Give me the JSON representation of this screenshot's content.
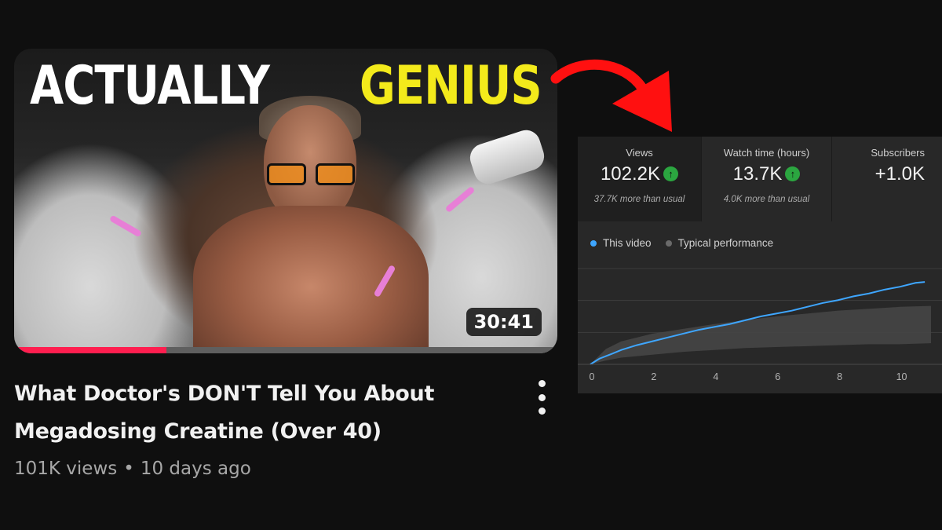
{
  "thumbnail": {
    "text_left": "ACTUALLY",
    "text_right": "GENIUS",
    "duration": "30:41",
    "watched_fraction": 0.28
  },
  "video": {
    "title_line1": "What Doctor's DON'T Tell You About",
    "title_line2": "Megadosing Creatine (Over 40)",
    "views": "101K views",
    "separator": "•",
    "age": "10 days ago",
    "menu_icon": "more-vert-icon"
  },
  "analytics": {
    "kpis": [
      {
        "label": "Views",
        "value": "102.2K",
        "trend": "up",
        "delta": "37.7K more than usual"
      },
      {
        "label": "Watch time (hours)",
        "value": "13.7K",
        "trend": "up",
        "delta": "4.0K more than usual"
      },
      {
        "label": "Subscribers",
        "value": "+1.0K"
      }
    ],
    "legend": [
      "This video",
      "Typical performance"
    ],
    "colors": {
      "this_video": "#3ea6ff",
      "typical": "#6a6a6a",
      "trend_up": "#2ba640"
    }
  },
  "chart_data": {
    "type": "line",
    "x_ticks": [
      "0",
      "2",
      "4",
      "6",
      "8",
      "10"
    ],
    "xlim": [
      0,
      11
    ],
    "ylim": [
      0,
      1
    ],
    "grid": true,
    "series": [
      {
        "name": "This video",
        "x": [
          0,
          0.3,
          0.7,
          1,
          1.5,
          2,
          2.5,
          3,
          3.5,
          4,
          4.5,
          5,
          5.5,
          6,
          6.5,
          7,
          7.5,
          8,
          8.5,
          9,
          9.5,
          10,
          10.5,
          10.8
        ],
        "y": [
          0,
          0.06,
          0.11,
          0.15,
          0.2,
          0.24,
          0.28,
          0.32,
          0.36,
          0.39,
          0.42,
          0.46,
          0.5,
          0.53,
          0.56,
          0.6,
          0.64,
          0.67,
          0.71,
          0.74,
          0.78,
          0.81,
          0.85,
          0.86
        ]
      }
    ],
    "typical_band": {
      "name": "Typical performance",
      "x": [
        0,
        0.5,
        1,
        2,
        3,
        4,
        5,
        6,
        7,
        8,
        9,
        10,
        11
      ],
      "upper": [
        0,
        0.16,
        0.24,
        0.32,
        0.37,
        0.42,
        0.46,
        0.5,
        0.53,
        0.56,
        0.58,
        0.6,
        0.61
      ],
      "lower": [
        0,
        0.04,
        0.07,
        0.1,
        0.13,
        0.15,
        0.17,
        0.18,
        0.19,
        0.2,
        0.21,
        0.21,
        0.22
      ]
    }
  }
}
